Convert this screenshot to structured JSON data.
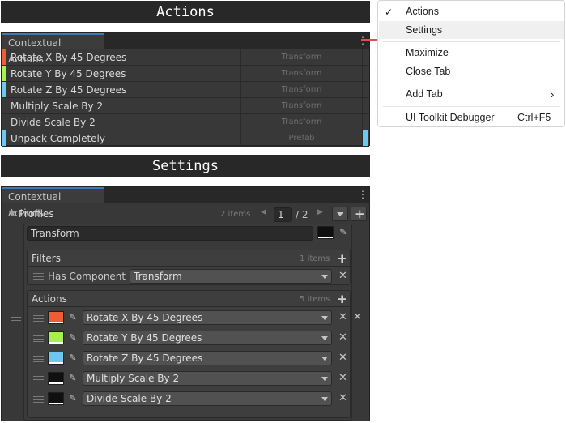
{
  "actions_section": {
    "title": "Actions"
  },
  "settings_section": {
    "title": "Settings"
  },
  "actions_window": {
    "tab_label": "Contextual Actions",
    "rows": [
      {
        "name": "Rotate X By 45 Degrees",
        "category": "Transform",
        "color": "#f05c33"
      },
      {
        "name": "Rotate Y By 45 Degrees",
        "category": "Transform",
        "color": "#a8f04c"
      },
      {
        "name": "Rotate Z By 45 Degrees",
        "category": "Transform",
        "color": "#6cc8f0"
      },
      {
        "name": "Multiply Scale By 2",
        "category": "Transform",
        "color": ""
      },
      {
        "name": "Divide Scale By 2",
        "category": "Transform",
        "color": ""
      },
      {
        "name": "Unpack Completely",
        "category": "Prefab",
        "color": "#6cc8f0"
      }
    ]
  },
  "settings_window": {
    "tab_label": "Contextual Actions",
    "profiles": {
      "label": "Profiles",
      "count": "2 items",
      "page_value": "1",
      "page_total": "/ 2",
      "profile_name": "Transform"
    },
    "filters": {
      "label": "Filters",
      "count": "1 items",
      "items": [
        {
          "label": "Has Component",
          "value": "Transform"
        }
      ]
    },
    "actions": {
      "label": "Actions",
      "count": "5 items",
      "items": [
        {
          "value": "Rotate X By 45 Degrees",
          "color": "#f05c33"
        },
        {
          "value": "Rotate Y By 45 Degrees",
          "color": "#a8f04c"
        },
        {
          "value": "Rotate Z By 45 Degrees",
          "color": "#6cc8f0"
        },
        {
          "value": "Multiply Scale By 2",
          "color": "#101010"
        },
        {
          "value": "Divide Scale By 2",
          "color": "#101010"
        }
      ]
    }
  },
  "context_menu": {
    "items": {
      "actions": "Actions",
      "settings": "Settings",
      "maximize": "Maximize",
      "close_tab": "Close Tab",
      "add_tab": "Add Tab",
      "debugger": "UI Toolkit Debugger",
      "debugger_shortcut": "Ctrl+F5"
    }
  },
  "colors": {
    "accent_arrow": "#e05050",
    "panel_bg": "#383838",
    "highlight": "#f0f0f0"
  }
}
